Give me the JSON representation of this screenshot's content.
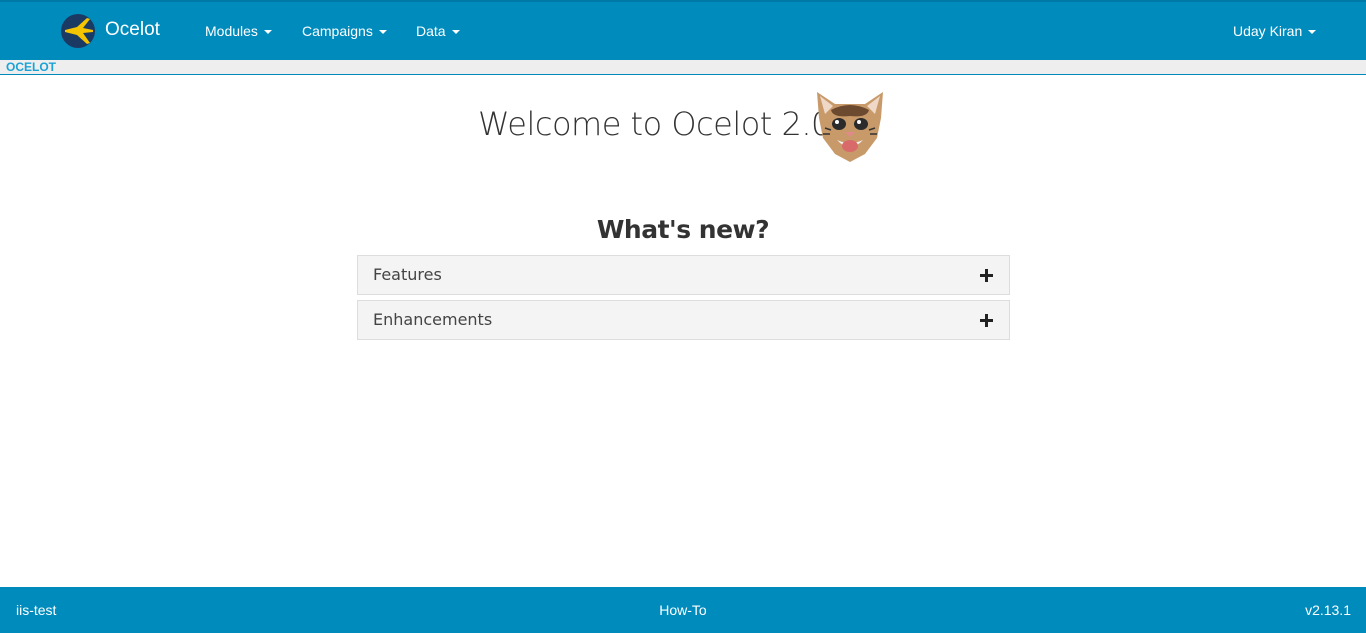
{
  "navbar": {
    "brand": "Ocelot",
    "menus": [
      {
        "label": "Modules"
      },
      {
        "label": "Campaigns"
      },
      {
        "label": "Data"
      }
    ],
    "user": "Uday Kiran"
  },
  "breadcrumb": {
    "label": "OCELOT"
  },
  "main": {
    "welcome_title": "Welcome to Ocelot 2.0",
    "whats_new_title": "What's new?",
    "panels": [
      {
        "title": "Features",
        "icon": "plus-icon"
      },
      {
        "title": "Enhancements",
        "icon": "plus-icon"
      }
    ]
  },
  "footer": {
    "left": "iis-test",
    "center": "How-To",
    "right": "v2.13.1"
  },
  "colors": {
    "navbar": "#008bbd",
    "footer": "#008bbd",
    "breadcrumb_link": "#1aa3d6",
    "panel_bg": "#f4f4f4"
  }
}
